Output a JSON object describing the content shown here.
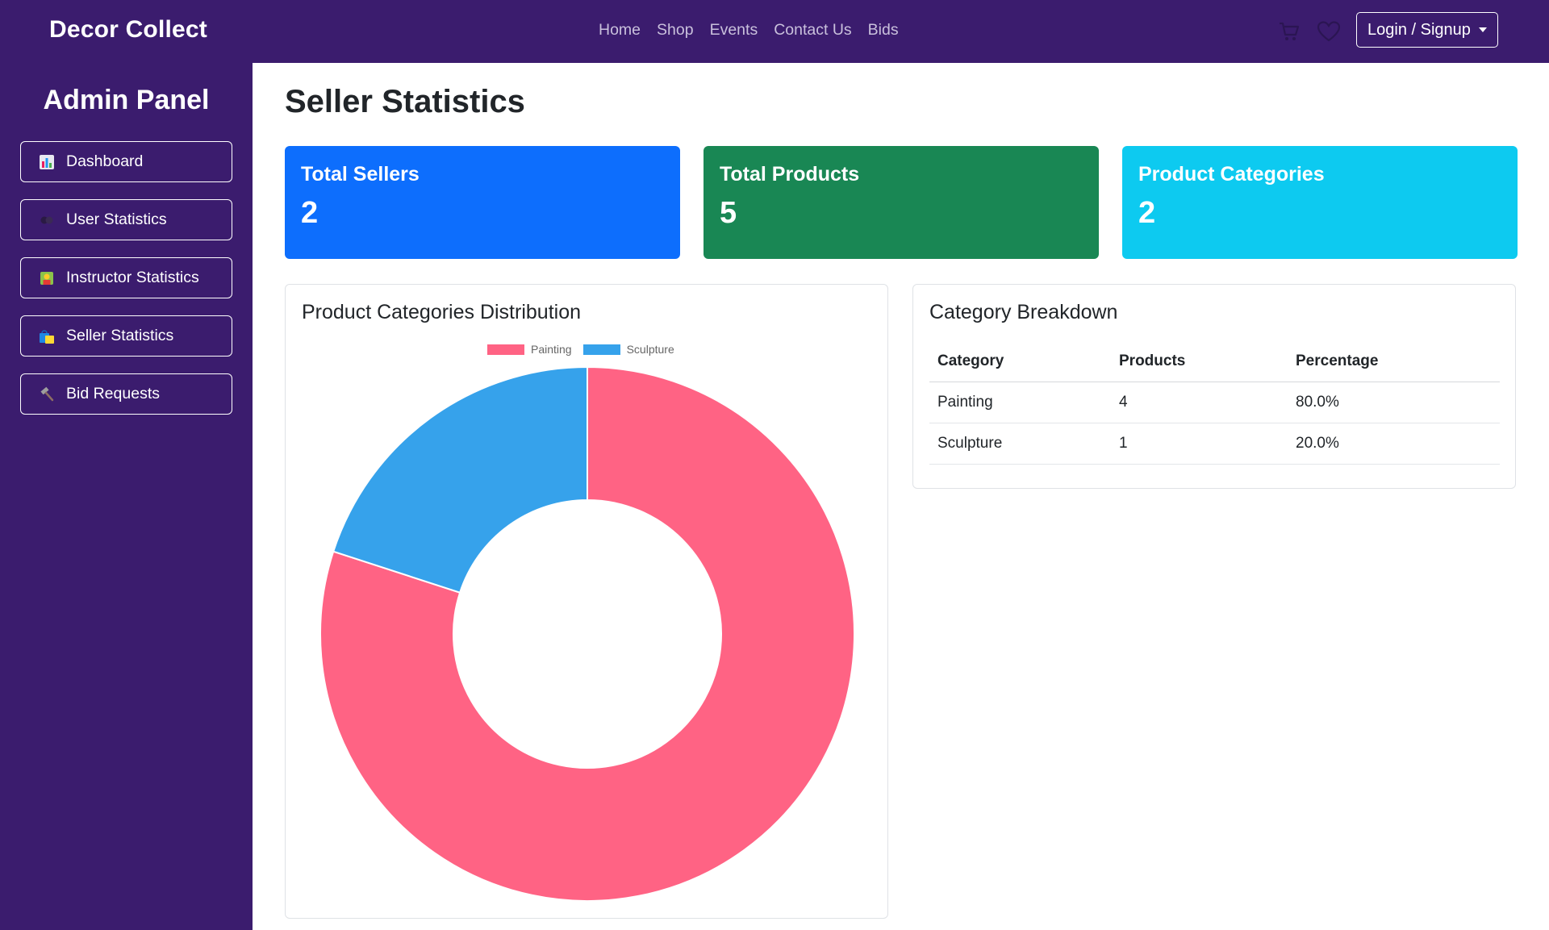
{
  "navbar": {
    "brand": "Decor Collect",
    "links": [
      "Home",
      "Shop",
      "Events",
      "Contact Us",
      "Bids"
    ],
    "cart_icon": "cart-icon",
    "heart_icon": "heart-icon",
    "login_label": "Login / Signup"
  },
  "sidebar": {
    "title": "Admin Panel",
    "items": [
      {
        "label": "Dashboard",
        "icon": "bar-chart-icon"
      },
      {
        "label": "User Statistics",
        "icon": "users-icon"
      },
      {
        "label": "Instructor Statistics",
        "icon": "instructor-icon"
      },
      {
        "label": "Seller Statistics",
        "icon": "shopping-bags-icon"
      },
      {
        "label": "Bid Requests",
        "icon": "hammer-icon"
      }
    ]
  },
  "main": {
    "title": "Seller Statistics",
    "stats": [
      {
        "label": "Total Sellers",
        "value": "2",
        "color": "#0d6efd"
      },
      {
        "label": "Total Products",
        "value": "5",
        "color": "#198754"
      },
      {
        "label": "Product Categories",
        "value": "2",
        "color": "#0dcaf0"
      }
    ],
    "chart_card": {
      "title": "Product Categories Distribution"
    },
    "breakdown": {
      "title": "Category Breakdown",
      "headers": [
        "Category",
        "Products",
        "Percentage"
      ],
      "rows": [
        [
          "Painting",
          "4",
          "80.0%"
        ],
        [
          "Sculpture",
          "1",
          "20.0%"
        ]
      ]
    }
  },
  "chart_data": {
    "type": "pie",
    "variant": "doughnut",
    "categories": [
      "Painting",
      "Sculpture"
    ],
    "values": [
      4,
      1
    ],
    "colors": [
      "#ff6384",
      "#36a2eb"
    ],
    "legend": "top"
  }
}
